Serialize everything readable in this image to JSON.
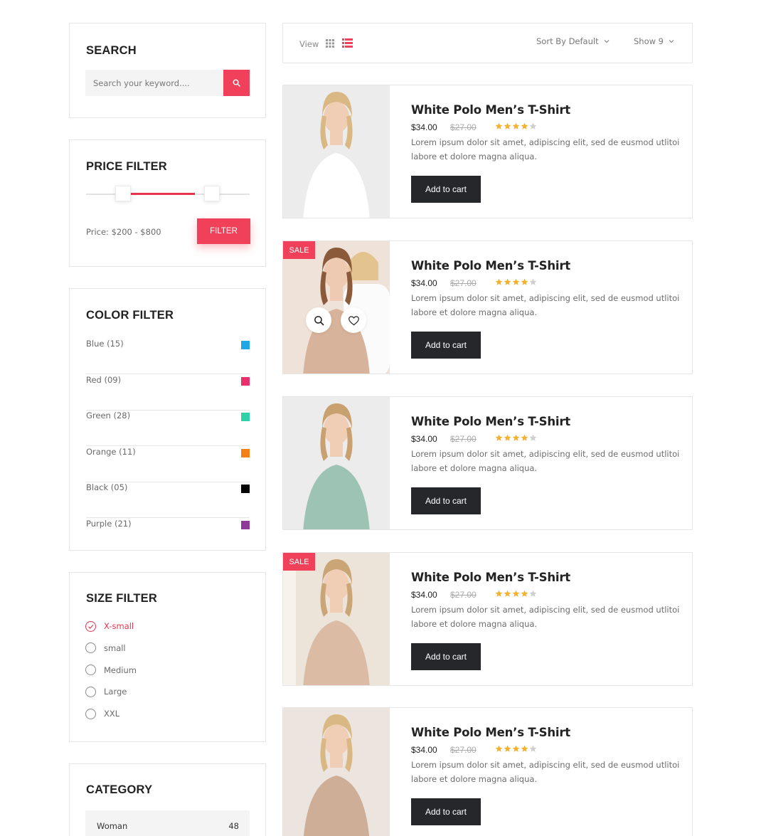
{
  "sidebar": {
    "search": {
      "title": "SEARCH",
      "placeholder": "Search your keyword....",
      "icon": "search-icon"
    },
    "price": {
      "title": "PRICE FILTER",
      "label": "Price: $200 - $800",
      "button": "FILTER",
      "min": 200,
      "max": 800
    },
    "color": {
      "title": "COLOR FILTER",
      "items": [
        {
          "label": "Blue (15)",
          "color": "#1ea7e4"
        },
        {
          "label": "Red (09)",
          "color": "#e82e6b"
        },
        {
          "label": "Green (28)",
          "color": "#2fd1a6"
        },
        {
          "label": "Orange (11)",
          "color": "#f57f17"
        },
        {
          "label": "Black (05)",
          "color": "#000000"
        },
        {
          "label": "Purple (21)",
          "color": "#8f3a99"
        }
      ]
    },
    "size": {
      "title": "SIZE FILTER",
      "items": [
        {
          "label": "X-small",
          "checked": true
        },
        {
          "label": "small",
          "checked": false
        },
        {
          "label": "Medium",
          "checked": false
        },
        {
          "label": "Large",
          "checked": false
        },
        {
          "label": "XXL",
          "checked": false
        }
      ]
    },
    "category": {
      "title": "CATEGORY",
      "items": [
        {
          "name": "Woman",
          "count": "48"
        }
      ]
    }
  },
  "toolbar": {
    "view_label": "View",
    "active_view": "list",
    "sort_label": "Sort By Default",
    "show_label": "Show 9"
  },
  "products": [
    {
      "title": "White Polo Men’s T-Shirt",
      "price": "$34.00",
      "old_price": "$27.00",
      "rating": 4,
      "desc": "Lorem ipsum dolor sit amet, adipiscing elit, sed de eusmod utlitoi labore et dolore magna aliqua.",
      "cta": "Add to cart",
      "sale": false,
      "hover": false
    },
    {
      "title": "White Polo Men’s T-Shirt",
      "price": "$34.00",
      "old_price": "$27.00",
      "rating": 4,
      "desc": "Lorem ipsum dolor sit amet, adipiscing elit, sed de eusmod utlitoi labore et dolore magna aliqua.",
      "cta": "Add to cart",
      "sale": true,
      "sale_label": "SALE",
      "hover": true
    },
    {
      "title": "White Polo Men’s T-Shirt",
      "price": "$34.00",
      "old_price": "$27.00",
      "rating": 4,
      "desc": "Lorem ipsum dolor sit amet, adipiscing elit, sed de eusmod utlitoi labore et dolore magna aliqua.",
      "cta": "Add to cart",
      "sale": false,
      "hover": false
    },
    {
      "title": "White Polo Men’s T-Shirt",
      "price": "$34.00",
      "old_price": "$27.00",
      "rating": 4,
      "desc": "Lorem ipsum dolor sit amet, adipiscing elit, sed de eusmod utlitoi labore et dolore magna aliqua.",
      "cta": "Add to cart",
      "sale": true,
      "sale_label": "SALE",
      "hover": false
    },
    {
      "title": "White Polo Men’s T-Shirt",
      "price": "$34.00",
      "old_price": "$27.00",
      "rating": 4,
      "desc": "Lorem ipsum dolor sit amet, adipiscing elit, sed de eusmod utlitoi labore et dolore magna aliqua.",
      "cta": "Add to cart",
      "sale": false,
      "hover": false
    }
  ],
  "colors": {
    "accent": "#f0405a",
    "dark": "#25272b",
    "star": "#f5b32f",
    "star_empty": "#cfcfcf"
  }
}
